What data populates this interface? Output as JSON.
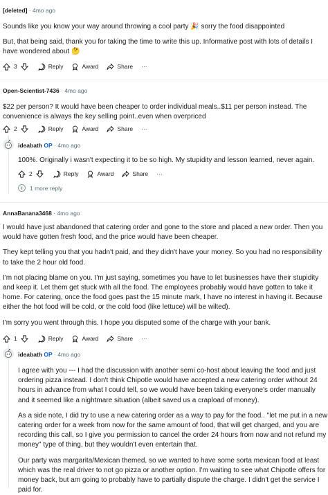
{
  "comments": [
    {
      "author": "[deleted]",
      "time": "4mo ago",
      "paragraphs": [
        "Sounds like you know your way around throwing a cool party 🎉 sorry the food disappointed",
        "But, that being said, thank you for taking the time to write this up. Informative post with lots of details I have wondered about 🤔"
      ],
      "votes": "3"
    },
    {
      "author": "Open-Scientist-7436",
      "time": "4mo ago",
      "paragraphs": [
        "$22 per person? It would have been cheaper to order individual meals..$11 per person instead. The convenience is always the key selling point..even when overpriced"
      ],
      "votes": "2"
    },
    {
      "author": "ideabath",
      "op_badge": "OP",
      "time": "4mo ago",
      "paragraphs": [
        "100%. Originally i wasn't expecting it to be so high. My stupidity and lesson learned, never again."
      ],
      "votes": "2",
      "more_replies": "1 more reply"
    },
    {
      "author": "AnnaBanana3468",
      "time": "4mo ago",
      "paragraphs": [
        "I would have just abandoned that catering order and gone to the store and placed a new order. Then you would have gotten fresh food, and the price would have been cheaper.",
        "They kept telling you that you hadn't paid, and they didn't have your money. So you had no responsibility to take the 2 hour old food.",
        "I'm not placing blame on you. I'm just saying, sometimes you have to let businesses have their stupidity and keep it. Let them get stuck with all the food. The employees probably would have gotten to take it home. For catering, once the food goes past the 15 minute mark, I have no interest in having it. Because either the hot food will be cold, or the cold food (like lettuce) will be wilted).",
        "I'm sorry you went through this. I hope you disputed some of the charge with your bank."
      ],
      "votes": "1"
    },
    {
      "author": "ideabath",
      "op_badge": "OP",
      "time": "4mo ago",
      "paragraphs": [
        "I agree with you --- I had the discussion with another semi co-host about leaving the food and just ordering pizza instead. I don't think Chipotle would have accepted a new catering order without 24 hours in advance from what I could tell, so we would have been taking everyone's order manually and it seemed like a nightmare situation (albeit saved us a crapload of money).",
        "As a side note, I did try to use a new catering order as a way to pay for the food.. \"let me put in a new catering order for a week from now for the same amount of food, that will get charged, and you are recording this call, so I give you permission to cancel the order 24 hours from now and not refund my money\" type of thing, but they wouldn't even entertain that.",
        "Our party was margarita/Mexican themed, so we wanted to have some sorta mexican food at least which was the real driver to not go pizza or another option. I'm waiting to see what Chipotle offers for money back, but am going to probably have to partially dispute the charge. I didn't get the service I paid for."
      ]
    }
  ],
  "actions": {
    "reply": "Reply",
    "award": "Award",
    "share": "Share",
    "more": "···"
  }
}
